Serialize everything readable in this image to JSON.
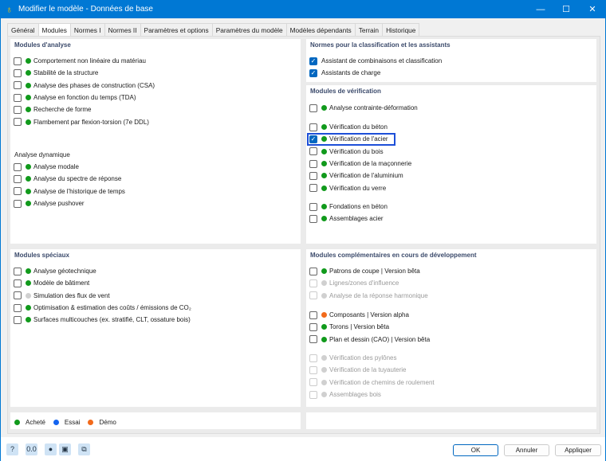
{
  "window": {
    "title": "Modifier le modèle - Données de base",
    "minimize": "—",
    "maximize": "☐",
    "close": "✕"
  },
  "tabs": [
    {
      "label": "Général"
    },
    {
      "label": "Modules",
      "active": true
    },
    {
      "label": "Normes I"
    },
    {
      "label": "Normes II"
    },
    {
      "label": "Paramètres et options"
    },
    {
      "label": "Paramètres du modèle"
    },
    {
      "label": "Modèles dépendants"
    },
    {
      "label": "Terrain"
    },
    {
      "label": "Historique"
    }
  ],
  "colors": {
    "purchased": "#119a1c",
    "trial": "#1464f0",
    "demo": "#f26a1b",
    "disabled": "#d0d0d0"
  },
  "analysis": {
    "title": "Modules d'analyse",
    "items": [
      {
        "label": "Comportement non linéaire du matériau",
        "status": "purchased"
      },
      {
        "label": "Stabilité de la structure",
        "status": "purchased"
      },
      {
        "label": "Analyse des phases de construction (CSA)",
        "status": "purchased"
      },
      {
        "label": "Analyse en fonction du temps (TDA)",
        "status": "purchased"
      },
      {
        "label": "Recherche de forme",
        "status": "purchased"
      },
      {
        "label": "Flambement par flexion-torsion (7e DDL)",
        "status": "purchased"
      }
    ],
    "dynamic_title": "Analyse dynamique",
    "dynamic": [
      {
        "label": "Analyse modale",
        "status": "purchased"
      },
      {
        "label": "Analyse du spectre de réponse",
        "status": "purchased"
      },
      {
        "label": "Analyse de l'historique de temps",
        "status": "purchased"
      },
      {
        "label": "Analyse pushover",
        "status": "purchased"
      }
    ]
  },
  "standards": {
    "title": "Normes pour la classification et les assistants",
    "items": [
      {
        "label": "Assistant de combinaisons et classification",
        "checked": true
      },
      {
        "label": "Assistants de charge",
        "checked": true
      }
    ]
  },
  "design": {
    "title": "Modules de vérification",
    "groups": [
      [
        {
          "label": "Analyse contrainte-déformation",
          "status": "purchased"
        }
      ],
      [
        {
          "label": "Vérification du béton",
          "status": "purchased"
        },
        {
          "label": "Vérification de l'acier",
          "status": "purchased",
          "checked": true,
          "highlighted": true
        },
        {
          "label": "Vérification du bois",
          "status": "purchased"
        },
        {
          "label": "Vérification de la maçonnerie",
          "status": "purchased"
        },
        {
          "label": "Vérification de l'aluminium",
          "status": "purchased"
        },
        {
          "label": "Vérification du verre",
          "status": "purchased"
        }
      ],
      [
        {
          "label": "Fondations en béton",
          "status": "purchased"
        },
        {
          "label": "Assemblages acier",
          "status": "purchased"
        }
      ]
    ]
  },
  "special": {
    "title": "Modules spéciaux",
    "items": [
      {
        "label": "Analyse géotechnique",
        "status": "purchased"
      },
      {
        "label": "Modèle de bâtiment",
        "status": "purchased"
      },
      {
        "label": "Simulation des flux de vent",
        "status": "disabled"
      },
      {
        "label": "Optimisation & estimation des coûts / émissions de CO₂",
        "status": "purchased"
      },
      {
        "label": "Surfaces multicouches (ex. stratifié, CLT, ossature bois)",
        "status": "purchased"
      }
    ]
  },
  "development": {
    "title": "Modules complémentaires en cours de développement",
    "groups": [
      [
        {
          "label": "Patrons de coupe | Version bêta",
          "status": "purchased"
        },
        {
          "label": "Lignes/zones d'influence",
          "status": "disabled",
          "disabled": true
        },
        {
          "label": "Analyse de la réponse harmonique",
          "status": "disabled",
          "disabled": true
        }
      ],
      [
        {
          "label": "Composants | Version alpha",
          "status": "demo"
        },
        {
          "label": "Torons | Version bêta",
          "status": "purchased"
        },
        {
          "label": "Plan et dessin (CAO) | Version bêta",
          "status": "purchased"
        }
      ],
      [
        {
          "label": "Vérification des pylônes",
          "status": "disabled",
          "disabled": true
        },
        {
          "label": "Vérification de la tuyauterie",
          "status": "disabled",
          "disabled": true
        },
        {
          "label": "Vérification de chemins de roulement",
          "status": "disabled",
          "disabled": true
        },
        {
          "label": "Assemblages bois",
          "status": "disabled",
          "disabled": true
        }
      ]
    ]
  },
  "legend": {
    "purchased": "Acheté",
    "trial": "Essai",
    "demo": "Démo"
  },
  "footer": {
    "icons": [
      "help-icon",
      "units-icon",
      "display-icon",
      "save-icon",
      "copy-icon"
    ],
    "ok": "OK",
    "cancel": "Annuler",
    "apply": "Appliquer"
  }
}
